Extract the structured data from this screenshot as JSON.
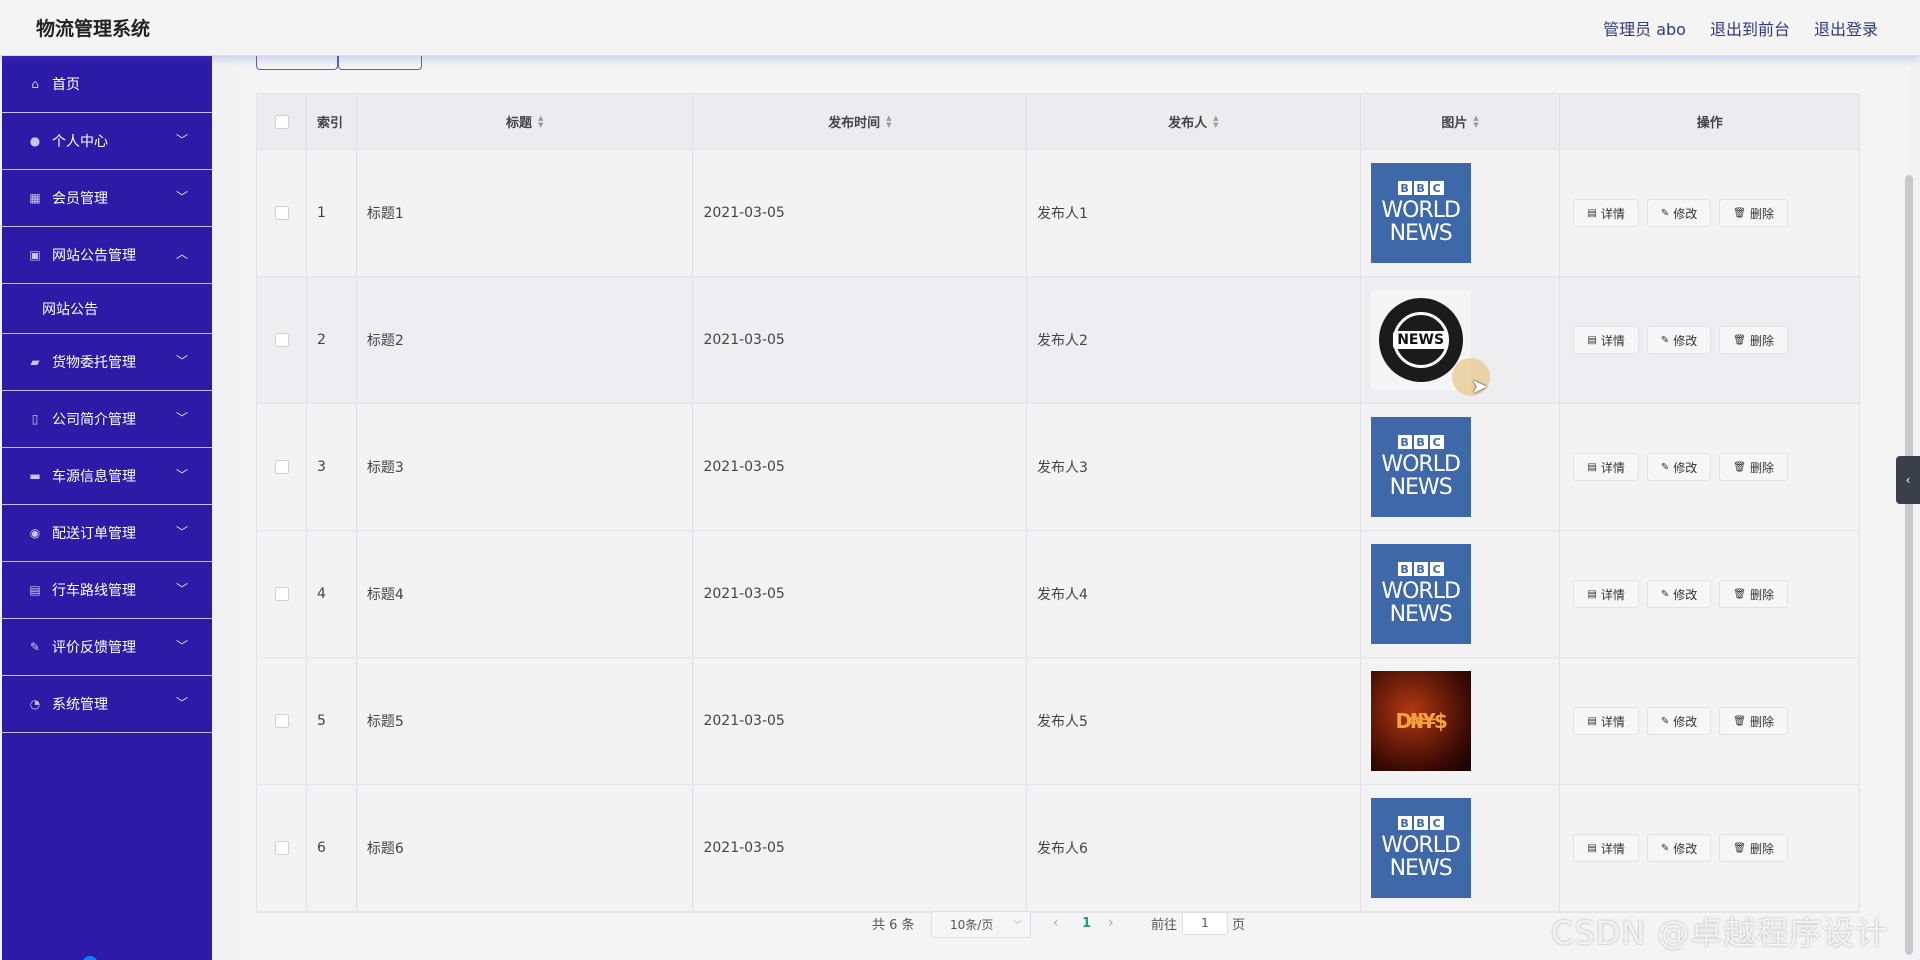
{
  "header": {
    "brand": "物流管理系统",
    "admin_label": "管理员 abo",
    "to_front": "退出到前台",
    "logout": "退出登录"
  },
  "sidebar": {
    "items": [
      {
        "label": "首页",
        "icon": "home-icon",
        "chevron": ""
      },
      {
        "label": "个人中心",
        "icon": "user-icon",
        "chevron": "﹀"
      },
      {
        "label": "会员管理",
        "icon": "grid-icon",
        "chevron": "﹀"
      },
      {
        "label": "网站公告管理",
        "icon": "briefcase-icon",
        "chevron": "︿"
      },
      {
        "label": "网站公告",
        "sub": true
      },
      {
        "label": "货物委托管理",
        "icon": "truck-icon",
        "chevron": "﹀"
      },
      {
        "label": "公司简介管理",
        "icon": "phone-icon",
        "chevron": "﹀"
      },
      {
        "label": "车源信息管理",
        "icon": "chat-icon",
        "chevron": "﹀"
      },
      {
        "label": "配送订单管理",
        "icon": "pin-icon",
        "chevron": "﹀"
      },
      {
        "label": "行车路线管理",
        "icon": "clipboard-icon",
        "chevron": "﹀"
      },
      {
        "label": "评价反馈管理",
        "icon": "edit-icon",
        "chevron": "﹀"
      },
      {
        "label": "系统管理",
        "icon": "gauge-icon",
        "chevron": "﹀"
      }
    ]
  },
  "table": {
    "columns": {
      "index": "索引",
      "title": "标题",
      "time": "发布时间",
      "publisher": "发布人",
      "image": "图片",
      "actions": "操作"
    },
    "rows": [
      {
        "index": "1",
        "title": "标题1",
        "time": "2021-03-05",
        "publisher": "发布人1",
        "image": "bbc"
      },
      {
        "index": "2",
        "title": "标题2",
        "time": "2021-03-05",
        "publisher": "发布人2",
        "image": "globe"
      },
      {
        "index": "3",
        "title": "标题3",
        "time": "2021-03-05",
        "publisher": "发布人3",
        "image": "bbc"
      },
      {
        "index": "4",
        "title": "标题4",
        "time": "2021-03-05",
        "publisher": "发布人4",
        "image": "bbc"
      },
      {
        "index": "5",
        "title": "标题5",
        "time": "2021-03-05",
        "publisher": "发布人5",
        "image": "money"
      },
      {
        "index": "6",
        "title": "标题6",
        "time": "2021-03-05",
        "publisher": "发布人6",
        "image": "bbc"
      }
    ],
    "actions": {
      "detail": "详情",
      "edit": "修改",
      "delete": "删除"
    }
  },
  "thumbs": {
    "bbc_blocks": [
      "B",
      "B",
      "C"
    ],
    "bbc_line1": "WORLD",
    "bbc_line2": "NEWS",
    "globe_label": "NEWS",
    "money_text": "D₦¥$"
  },
  "pager": {
    "total": "共 6 条",
    "page_size": "10条/页",
    "current_page": "1",
    "goto_prefix": "前往",
    "goto_value": "1",
    "goto_suffix": "页"
  },
  "watermark": "CSDN @卓越程序设计",
  "colors": {
    "sidebar_bg": "#2d1ba8",
    "accent_green": "#1aa37a",
    "bbc_blue": "#3f68a8"
  }
}
